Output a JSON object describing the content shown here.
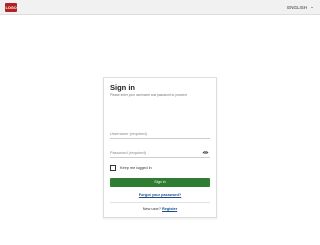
{
  "header": {
    "logo_text": "LOGO",
    "language_label": "ENGLISH"
  },
  "login": {
    "title": "Sign in",
    "subtitle": "Please enter your username and password to proceed",
    "username_placeholder": "Username (required)",
    "password_placeholder": "Password (required)",
    "remember_label": "Keep me logged in",
    "signin_label": "Sign in",
    "forgot_label": "Forgot your password?",
    "newuser_prefix": "New user?",
    "register_label": "Register"
  },
  "colors": {
    "signin_button": "#2e7d32",
    "link": "#1a4f8b",
    "logo": "#b22222"
  },
  "icons": {
    "eye": "eye-icon",
    "caret": "chevron-down-icon"
  }
}
